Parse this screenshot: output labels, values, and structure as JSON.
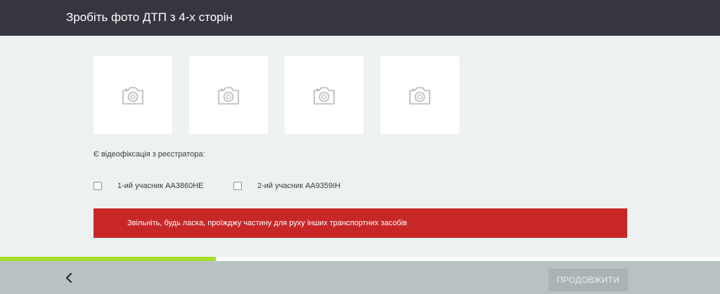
{
  "header": {
    "title": "Зробіть фото ДТП з 4-х сторін"
  },
  "photos": {
    "slots": [
      {
        "icon": "camera-icon"
      },
      {
        "icon": "camera-icon"
      },
      {
        "icon": "camera-icon"
      },
      {
        "icon": "camera-icon"
      }
    ]
  },
  "recorder": {
    "question": "Є відеофіксація з реєстратора:",
    "participants": [
      {
        "label": "1-ий учасник",
        "plate": "AA3860HE",
        "checked": false
      },
      {
        "label": "2-ий учасник",
        "plate": "AA9359IH",
        "checked": false
      }
    ]
  },
  "alert": {
    "text": "Звільніть, будь ласка, проїжджу частину для руху інших транспортних засобів",
    "color": "#c82727"
  },
  "progress": {
    "fraction": 0.3,
    "color": "#a6de2b"
  },
  "footer": {
    "back_icon": "chevron-left-icon",
    "continue_label": "ПРОДОВЖИТИ"
  }
}
